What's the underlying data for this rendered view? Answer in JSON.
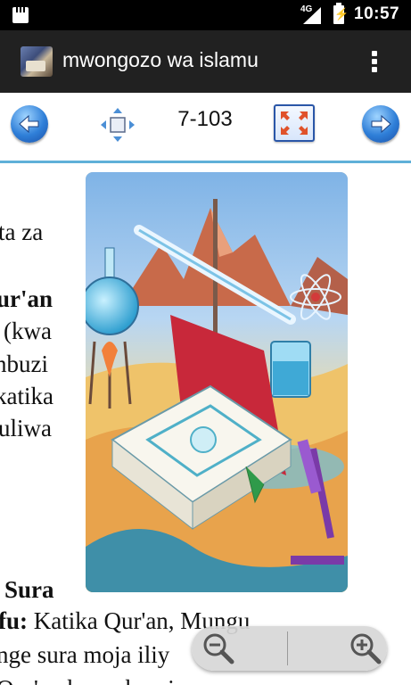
{
  "status": {
    "network": "4G",
    "time": "10:57",
    "icons": [
      "sd-card-icon",
      "signal-icon",
      "battery-charging-icon"
    ]
  },
  "appbar": {
    "title": "mwongozo wa islamu",
    "icon": "app-logo-icon",
    "menu_icon": "overflow-menu-icon"
  },
  "toolbar": {
    "page": "7-103",
    "back_icon": "arrow-left-icon",
    "move_icon": "move-icon",
    "fullscreen_icon": "fullscreen-icon",
    "forward_icon": "arrow-right-icon",
    "accent": "#5fb0d8"
  },
  "document": {
    "lines_left": [
      "ta  za",
      "ur'an",
      "(kwa",
      "nbuzi",
      "katika",
      "uliwa"
    ],
    "sura_heading": "Sura",
    "bottom_line1_bold": "fu:",
    "bottom_line1_rest": " Katika  Qur'an,   Mungu",
    "bottom_line2": "nge sura moja iliy",
    "bottom_line3": "Qur'an   kama  kumi  na  nne"
  },
  "zoom": {
    "out_icon": "zoom-out-icon",
    "in_icon": "zoom-in-icon"
  }
}
